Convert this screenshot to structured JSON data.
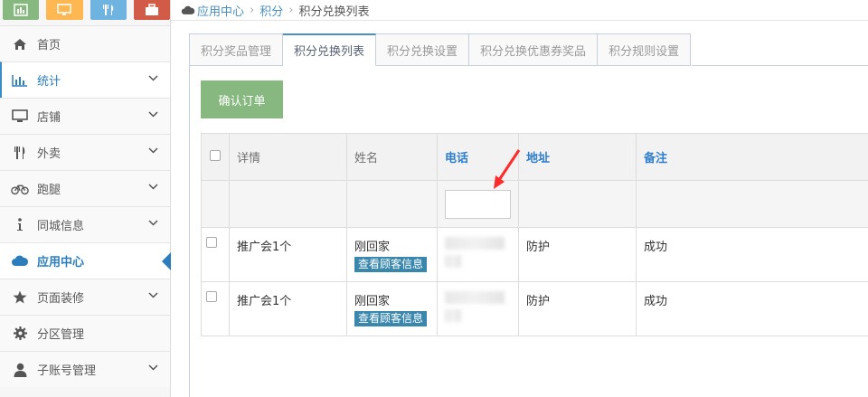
{
  "sidebar": {
    "shortcuts": [
      {
        "name": "bar-chart-icon",
        "color": "#87b87f"
      },
      {
        "name": "monitor-icon",
        "color": "#ffb752"
      },
      {
        "name": "utensils-icon",
        "color": "#6fb3e0"
      },
      {
        "name": "briefcase-icon",
        "color": "#d15b47"
      }
    ],
    "items": [
      {
        "label": "首页",
        "icon": "home-icon"
      },
      {
        "label": "统计",
        "icon": "bar-chart-icon"
      },
      {
        "label": "店铺",
        "icon": "monitor-icon"
      },
      {
        "label": "外卖",
        "icon": "utensils-icon"
      },
      {
        "label": "跑腿",
        "icon": "bicycle-icon"
      },
      {
        "label": "同城信息",
        "icon": "info-icon"
      },
      {
        "label": "应用中心",
        "icon": "cloud-icon"
      },
      {
        "label": "页面装修",
        "icon": "star-icon"
      },
      {
        "label": "分区管理",
        "icon": "gear-icon"
      },
      {
        "label": "子账号管理",
        "icon": "user-icon"
      }
    ]
  },
  "breadcrumb": {
    "home": "应用中心",
    "level2": "积分",
    "current": "积分兑换列表"
  },
  "tabs": [
    "积分奖品管理",
    "积分兑换列表",
    "积分兑换设置",
    "积分兑换优惠券奖品",
    "积分规则设置"
  ],
  "toolbar": {
    "confirm_label": "确认订单"
  },
  "table": {
    "headers": {
      "detail": "详情",
      "name": "姓名",
      "phone": "电话",
      "address": "地址",
      "note": "备注"
    },
    "rows": [
      {
        "detail": "推广会1个",
        "name": "刚回家",
        "view": "查看顾客信息",
        "address": "防护",
        "note": "成功"
      },
      {
        "detail": "推广会1个",
        "name": "刚回家",
        "view": "查看顾客信息",
        "address": "防护",
        "note": "成功"
      }
    ]
  }
}
